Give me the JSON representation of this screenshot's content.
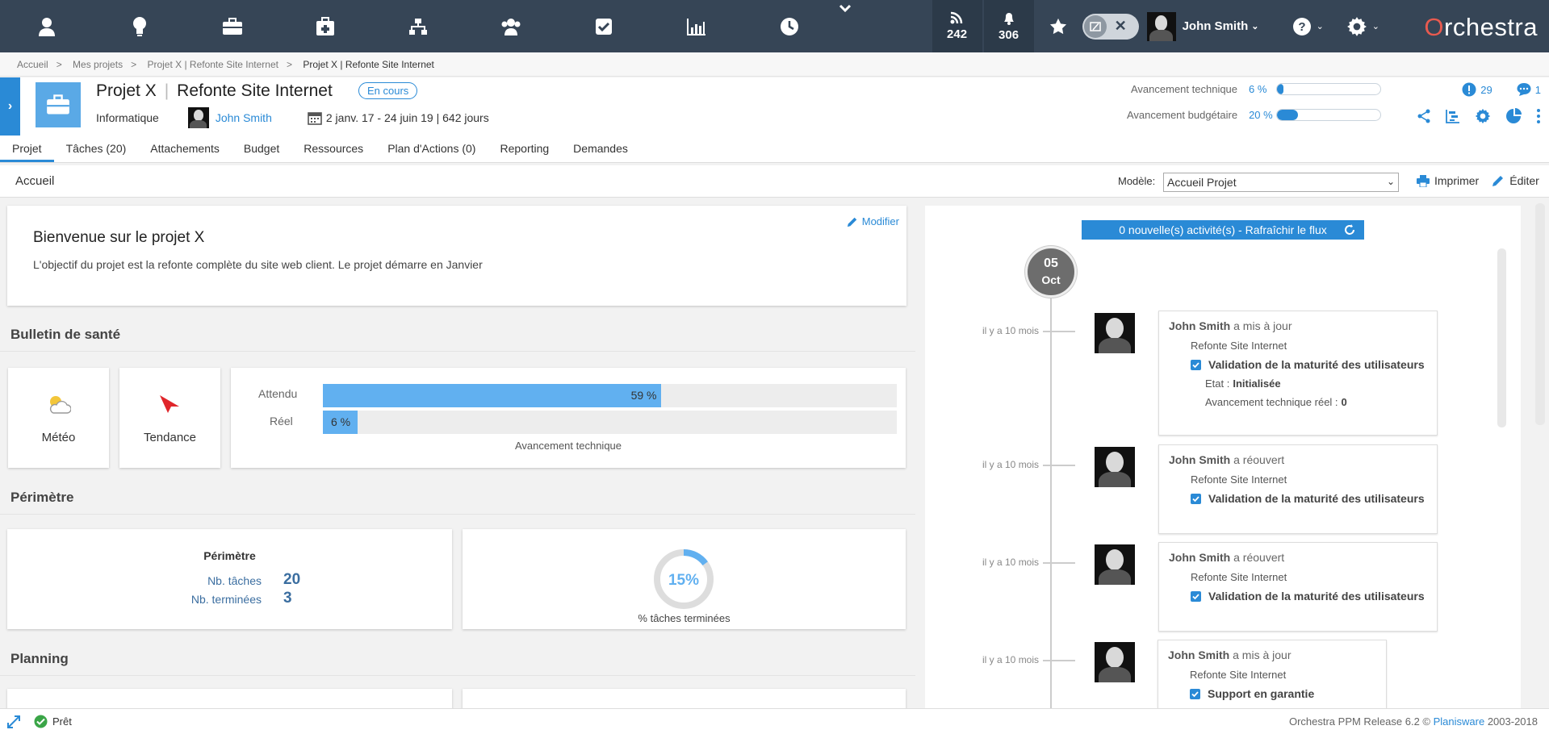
{
  "topbar": {
    "rss_count": "242",
    "notif_count": "306",
    "user_name": "John Smith",
    "brand": "rchestra",
    "brand_first": "O"
  },
  "breadcrumb": [
    "Accueil",
    "Mes projets",
    "Projet X | Refonte Site Internet",
    "Projet X | Refonte Site Internet"
  ],
  "project": {
    "code": "Projet X",
    "name": "Refonte Site Internet",
    "status": "En cours",
    "category": "Informatique",
    "owner": "John Smith",
    "dates": "2 janv. 17 - 24 juin 19 | 642 jours",
    "tech_label": "Avancement technique",
    "tech_value": "6 %",
    "tech_fraction": 0.06,
    "budget_label": "Avancement budgétaire",
    "budget_value": "20 %",
    "budget_fraction": 0.2,
    "alerts_count": "29",
    "comments_count": "1"
  },
  "tabs": [
    "Projet",
    "Tâches (20)",
    "Attachements",
    "Budget",
    "Ressources",
    "Plan d'Actions (0)",
    "Reporting",
    "Demandes"
  ],
  "subbar": {
    "home": "Accueil",
    "modele_label": "Modèle:",
    "modele_value": "Accueil Projet",
    "print": "Imprimer",
    "edit": "Éditer"
  },
  "welcome": {
    "edit": "Modifier",
    "title": "Bienvenue sur le projet X",
    "text": "L'objectif du projet est la refonte complète du site web client. Le projet démarre en Janvier"
  },
  "health": {
    "title": "Bulletin de santé",
    "meteo": "Météo",
    "tendance": "Tendance",
    "expected_label": "Attendu",
    "expected_value": "59 %",
    "expected_fraction": 0.59,
    "real_label": "Réel",
    "real_value": "6 %",
    "real_fraction": 0.06,
    "caption": "Avancement technique"
  },
  "scope": {
    "title": "Périmètre",
    "card_title": "Périmètre",
    "tasks_label": "Nb. tâches",
    "tasks_value": "20",
    "done_label": "Nb. terminées",
    "done_value": "3",
    "donut_value": "15%",
    "donut_fraction": 0.15,
    "donut_caption": "% tâches terminées"
  },
  "planning": {
    "title": "Planning"
  },
  "feed": {
    "refresh": "0 nouvelle(s) activité(s) - Rafraîchir le flux",
    "day": "05",
    "month": "Oct",
    "items": [
      {
        "ago": "il y a 10 mois",
        "who": "John Smith",
        "action": "a mis à jour",
        "project": "Refonte Site Internet",
        "task": "Validation de la maturité des utilisateurs",
        "etat_label": "Etat :",
        "etat_value": "Initialisée",
        "av_label": "Avancement technique réel :",
        "av_value": "0"
      },
      {
        "ago": "il y a 10 mois",
        "who": "John Smith",
        "action": "a réouvert",
        "project": "Refonte Site Internet",
        "task": "Validation de la maturité des utilisateurs"
      },
      {
        "ago": "il y a 10 mois",
        "who": "John Smith",
        "action": "a réouvert",
        "project": "Refonte Site Internet",
        "task": "Validation de la maturité des utilisateurs"
      },
      {
        "ago": "il y a 10 mois",
        "who": "John Smith",
        "action": "a mis à jour",
        "project": "Refonte Site Internet",
        "task": "Support en garantie"
      }
    ]
  },
  "status": {
    "ready": "Prêt",
    "copyright_a": "Orchestra PPM Release 6.2 © ",
    "copyright_link": "Planisware",
    "copyright_b": " 2003-2018"
  },
  "colors": {
    "accent": "#2a8ad6",
    "topbar": "#364556",
    "bar_light": "#61b0f0"
  }
}
